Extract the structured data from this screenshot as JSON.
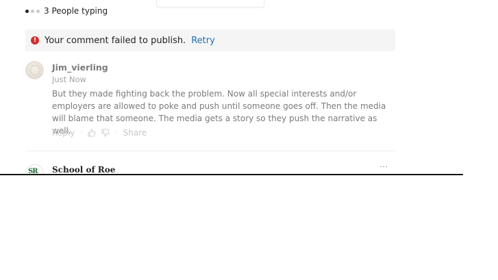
{
  "typing": {
    "text": "3 People typing"
  },
  "error_banner": {
    "message": "Your comment failed to publish.",
    "retry_label": "Retry",
    "icon": "exclamation-icon",
    "icon_color": "#d32f2f",
    "link_color": "#1d6fb8"
  },
  "comment": {
    "username": "Jim_vierling",
    "timestamp": "Just Now",
    "body": "But they made fighting back the problem. Now all special interests and/or employers are allowed to poke and push until someone goes off. Then the media will blame that someone. The media gets a story so they push the narrative as well.",
    "actions": {
      "reply_label": "Reply",
      "share_label": "Share",
      "separator": "·"
    }
  },
  "comment2": {
    "username": "School of Roe",
    "more_label": "···"
  }
}
